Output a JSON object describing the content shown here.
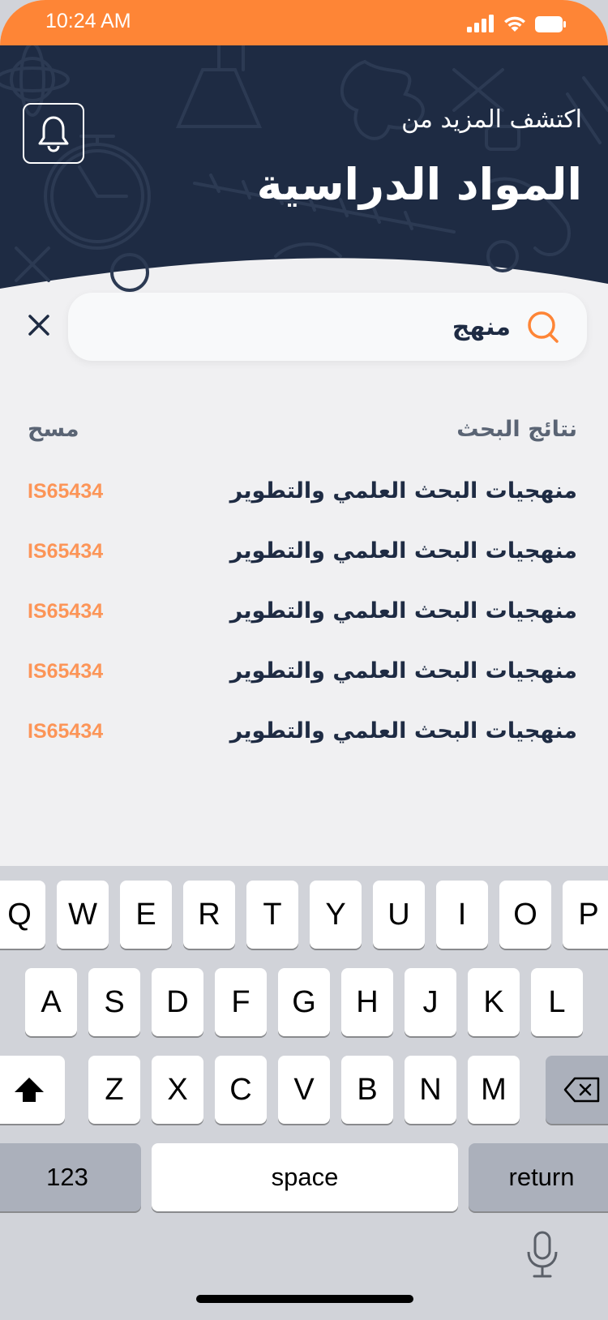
{
  "status_bar": {
    "time": "10:24 AM"
  },
  "header": {
    "subtitle": "اكتشف المزيد من",
    "title": "المواد الدراسية"
  },
  "search": {
    "value": "منهج"
  },
  "results": {
    "title": "نتائج البحث",
    "clear_label": "مسح",
    "items": [
      {
        "name": "منهجيات البحث العلمي والتطوير",
        "code": "IS65434"
      },
      {
        "name": "منهجيات البحث العلمي والتطوير",
        "code": "IS65434"
      },
      {
        "name": "منهجيات البحث العلمي والتطوير",
        "code": "IS65434"
      },
      {
        "name": "منهجيات البحث العلمي والتطوير",
        "code": "IS65434"
      },
      {
        "name": "منهجيات البحث العلمي والتطوير",
        "code": "IS65434"
      }
    ]
  },
  "keyboard": {
    "row1": [
      "Q",
      "W",
      "E",
      "R",
      "T",
      "Y",
      "U",
      "I",
      "O",
      "P"
    ],
    "row2": [
      "A",
      "S",
      "D",
      "F",
      "G",
      "H",
      "J",
      "K",
      "L"
    ],
    "row3": [
      "Z",
      "X",
      "C",
      "V",
      "B",
      "N",
      "M"
    ],
    "numbers_label": "123",
    "space_label": "space",
    "return_label": "return"
  },
  "colors": {
    "accent": "#fe8536",
    "header_bg": "#1e2b43",
    "code_color": "#fc9558"
  }
}
